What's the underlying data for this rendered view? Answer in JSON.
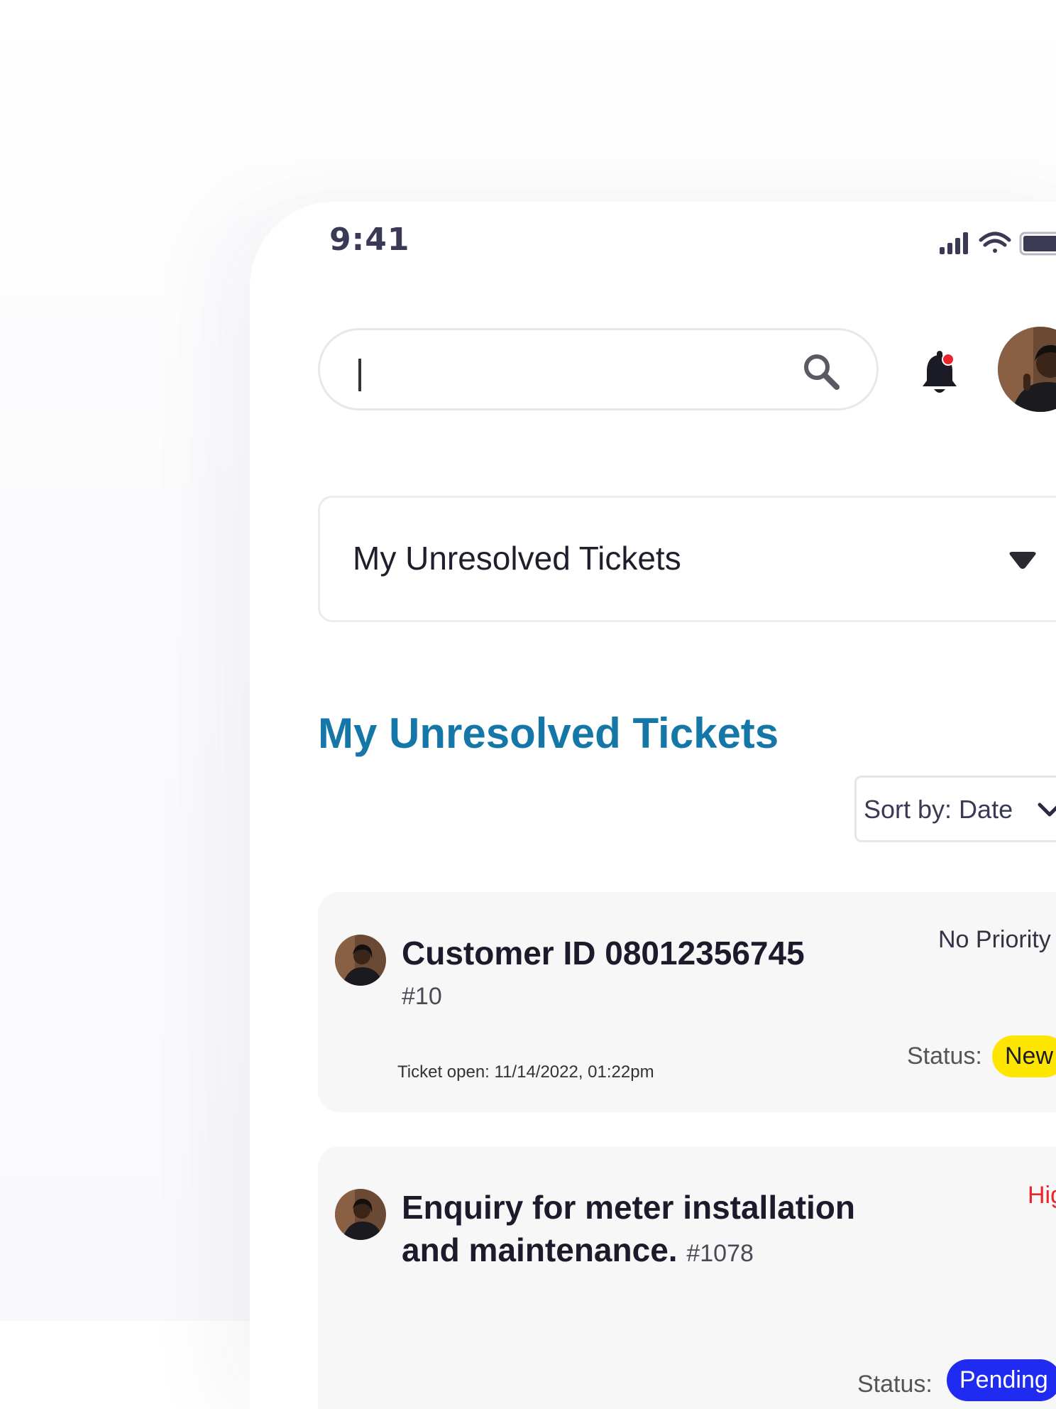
{
  "status_bar": {
    "time": "9:41",
    "icons": [
      "cellular-signal-icon",
      "wifi-icon",
      "battery-icon"
    ]
  },
  "search": {
    "placeholder": "",
    "value": ""
  },
  "notifications": {
    "has_unread": true,
    "dot_color": "#e8262b"
  },
  "filter_dropdown": {
    "selected": "My Unresolved Tickets"
  },
  "section": {
    "title": "My Unresolved Tickets",
    "title_color": "#1577a8"
  },
  "sort": {
    "label": "Sort by: Date"
  },
  "tickets": [
    {
      "title": "Customer ID 08012356745",
      "number": "#10",
      "priority": "No Priority",
      "priority_color": "#333344",
      "opened": "Ticket open: 11/14/2022, 01:22pm",
      "status_label": "Status:",
      "status": "New",
      "status_bg": "#ffe600",
      "status_fg": "#1b1b2b"
    },
    {
      "title_line1": "Enquiry for meter installation",
      "title_line2": "and maintenance.",
      "number": "#1078",
      "priority": "High",
      "priority_color": "#e8262b",
      "status_label": "Status:",
      "status": "Pending",
      "status_bg": "#1f2bf0",
      "status_fg": "#ffffff"
    }
  ]
}
